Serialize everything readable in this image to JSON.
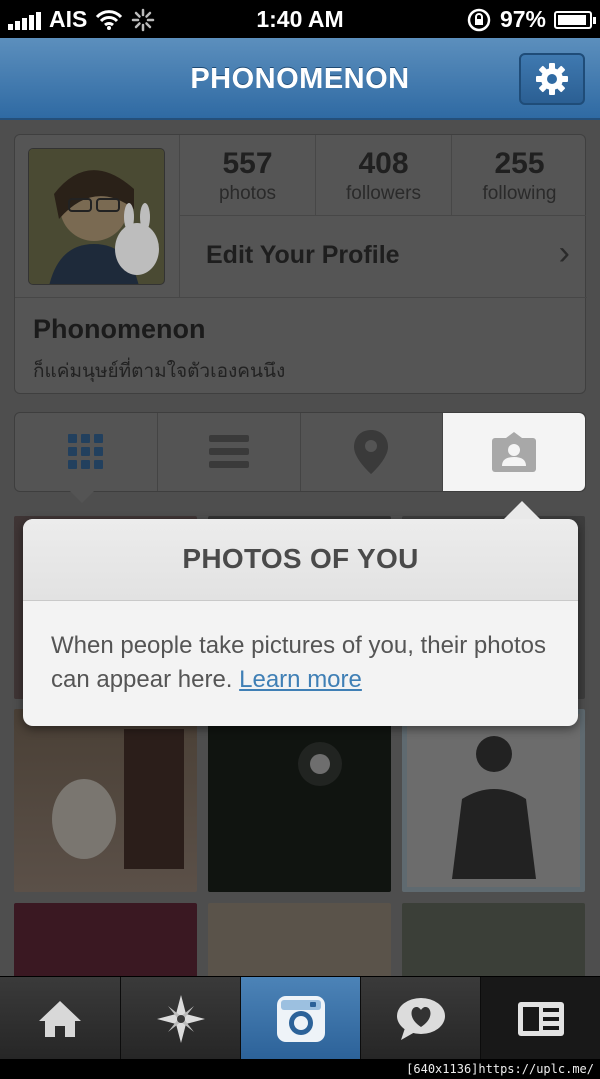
{
  "status_bar": {
    "carrier": "AIS",
    "time": "1:40 AM",
    "battery": "97%"
  },
  "nav": {
    "title": "PHONOMENON",
    "settings_icon": "gear-icon"
  },
  "profile": {
    "stats": [
      {
        "value": "557",
        "label": "photos"
      },
      {
        "value": "408",
        "label": "followers"
      },
      {
        "value": "255",
        "label": "following"
      }
    ],
    "edit_label": "Edit Your Profile",
    "name": "Phonomenon",
    "bio": "ก็แค่มนุษย์ที่ตามใจตัวเองคนนึง"
  },
  "view_tabs": [
    "grid-icon",
    "list-icon",
    "location-pin-icon",
    "photos-of-you-icon"
  ],
  "popup": {
    "title": "PHOTOS OF YOU",
    "body": "When people take pictures of you, their photos can appear here.",
    "link": "Learn more"
  },
  "tab_bar": [
    "home-icon",
    "explore-icon",
    "camera-icon",
    "news-icon",
    "profile-icon"
  ],
  "watermark": "[640x1136]https://uplc.me/"
}
